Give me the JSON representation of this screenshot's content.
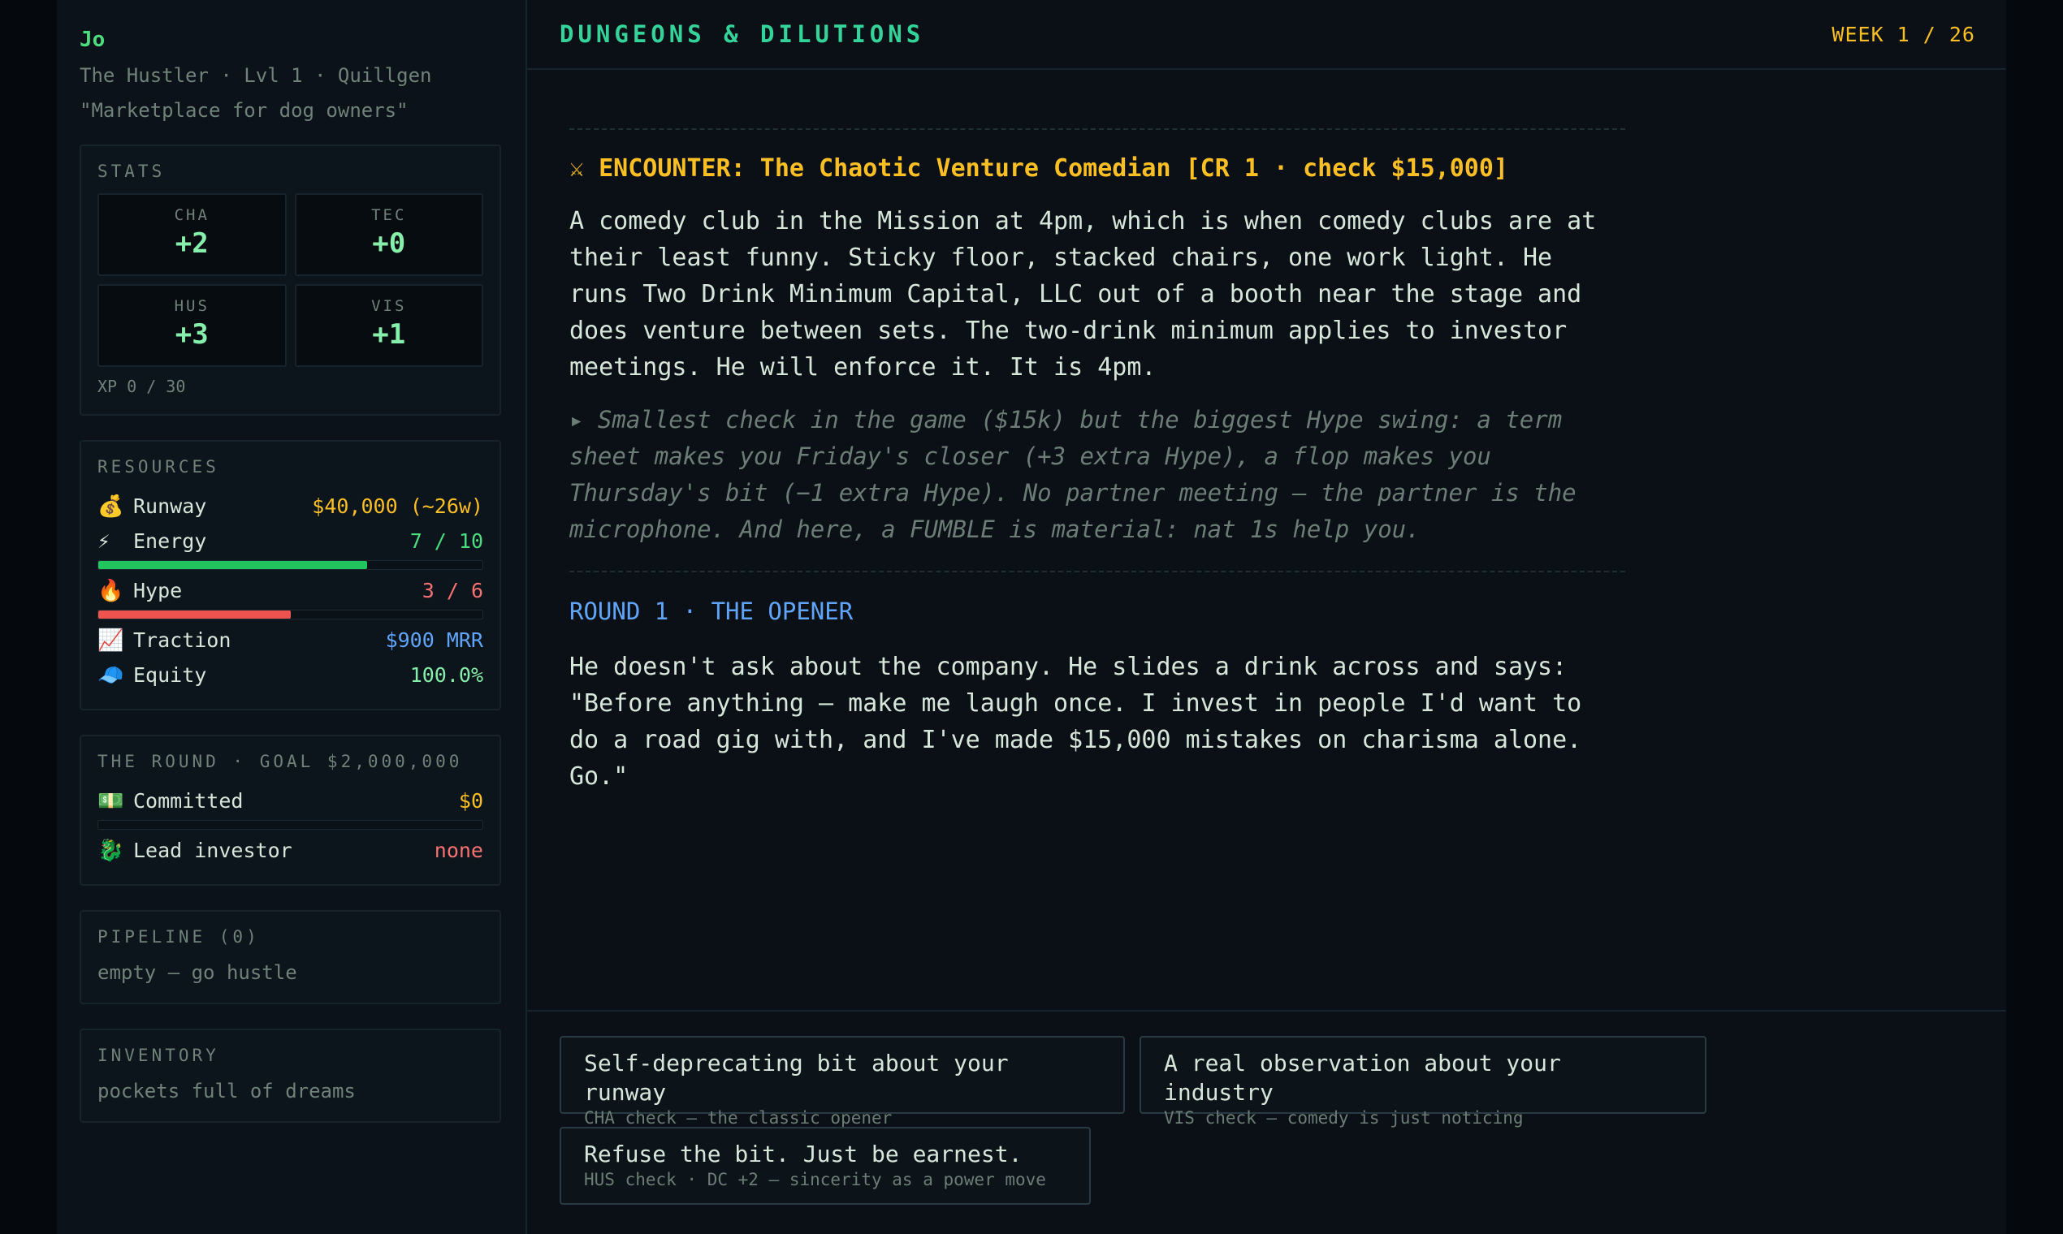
{
  "player": {
    "name": "Jo",
    "subtitle": "The Hustler · Lvl 1 · Quillgen",
    "idea": "\"Marketplace for dog owners\""
  },
  "stats": {
    "title": "STATS",
    "items": [
      {
        "label": "CHA",
        "value": "+2"
      },
      {
        "label": "TEC",
        "value": "+0"
      },
      {
        "label": "HUS",
        "value": "+3"
      },
      {
        "label": "VIS",
        "value": "+1"
      }
    ],
    "xp": "XP 0 / 30"
  },
  "resources": {
    "title": "RESOURCES",
    "runway": {
      "icon": "💰",
      "label": "Runway",
      "value": "$40,000 (~26w)"
    },
    "energy": {
      "icon": "⚡",
      "label": "Energy",
      "value": "7 / 10",
      "fraction": 0.7
    },
    "hype": {
      "icon": "🔥",
      "label": "Hype",
      "value": "3 / 6",
      "fraction": 0.5
    },
    "traction": {
      "icon": "📈",
      "label": "Traction",
      "value": "$900 MRR"
    },
    "equity": {
      "icon": "🧢",
      "label": "Equity",
      "value": "100.0%"
    }
  },
  "round": {
    "title": "THE ROUND · GOAL $2,000,000",
    "committed": {
      "icon": "💵",
      "label": "Committed",
      "value": "$0",
      "fraction": 0
    },
    "lead": {
      "icon": "🐉",
      "label": "Lead investor",
      "value": "none"
    }
  },
  "pipeline": {
    "title": "PIPELINE (0)",
    "empty": "empty — go hustle"
  },
  "inventory": {
    "title": "INVENTORY",
    "empty": "pockets full of dreams"
  },
  "header": {
    "title": "DUNGEONS & DILUTIONS",
    "week": "WEEK 1 / 26"
  },
  "encounter": {
    "title": "⚔ ENCOUNTER: The Chaotic Venture Comedian  [CR 1 · check $15,000]",
    "description": "A comedy club in the Mission at 4pm, which is when comedy clubs are at their least funny. Sticky floor, stacked chairs, one work light. He runs Two Drink Minimum Capital, LLC out of a booth near the stage and does venture between sets. The two-drink minimum applies to investor meetings. He will enforce it. It is 4pm.",
    "hint": "▸ Smallest check in the game ($15k) but the biggest Hype swing: a term sheet makes you Friday's closer (+3 extra Hype), a flop makes you Thursday's bit (−1 extra Hype). No partner meeting — the partner is the microphone. And here, a FUMBLE is material: nat 1s help you.",
    "round_title": "ROUND 1 · THE OPENER",
    "dialogue": "He doesn't ask about the company. He slides a drink across and says: \"Before anything — make me laugh once. I invest in people I'd want to do a road gig with, and I've made $15,000 mistakes on charisma alone. Go.\""
  },
  "choices": [
    {
      "label": "Self-deprecating bit about your runway",
      "sub": "CHA check — the classic opener"
    },
    {
      "label": "A real observation about your industry",
      "sub": "VIS check — comedy is just noticing"
    },
    {
      "label": "Refuse the bit. Just be earnest.",
      "sub": "HUS check · DC +2 — sincerity as a power move"
    }
  ],
  "colors": {
    "accent_green": "#4ade80",
    "gold": "#fbbf24",
    "hype_red": "#f87171",
    "blue": "#60a5fa"
  }
}
